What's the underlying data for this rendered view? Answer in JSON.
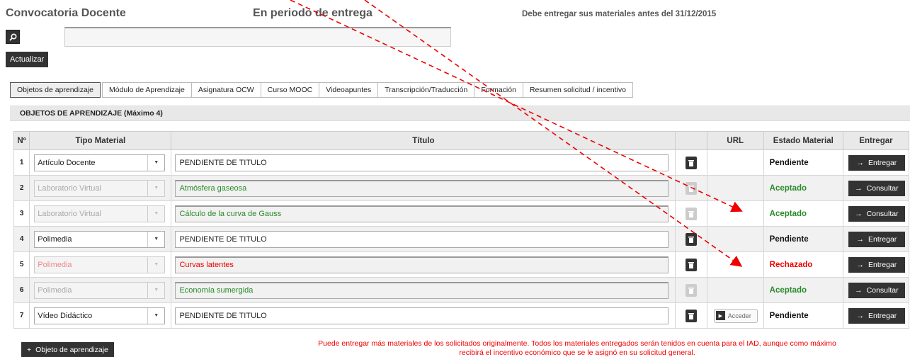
{
  "header": {
    "title": "Convocatoria Docente",
    "status": "En periodo de entrega",
    "note": "Debe entregar sus materiales antes del 31/12/2015"
  },
  "toolbar": {
    "update_label": "Actualizar",
    "search_icon": "search-icon"
  },
  "tabs": [
    {
      "label": "Objetos de aprendizaje",
      "active": true
    },
    {
      "label": "Módulo de Aprendizaje"
    },
    {
      "label": "Asignatura OCW"
    },
    {
      "label": "Curso MOOC"
    },
    {
      "label": "Videoapuntes"
    },
    {
      "label": "Transcripción/Traducción"
    },
    {
      "label": "Formación"
    },
    {
      "label": "Resumen solicitud / incentivo"
    }
  ],
  "section": {
    "title": "OBJETOS DE APRENDIZAJE (Máximo 4)"
  },
  "table": {
    "headers": {
      "num": "Nº",
      "tipo": "Tipo Material",
      "titulo": "Título",
      "url": "URL",
      "estado": "Estado Material",
      "entregar": "Entregar"
    },
    "rows": [
      {
        "n": "1",
        "tipo": "Artículo Docente",
        "titulo": "PENDIENTE DE TITULO",
        "estado": "Pendiente",
        "accion": "Entregar"
      },
      {
        "n": "2",
        "tipo": "Laboratorio Virtual",
        "titulo": "Atmósfera gaseosa",
        "estado": "Aceptado",
        "accion": "Consultar"
      },
      {
        "n": "3",
        "tipo": "Laboratorio Virtual",
        "titulo": "Cálculo de la curva de Gauss",
        "estado": "Aceptado",
        "accion": "Consultar"
      },
      {
        "n": "4",
        "tipo": "Polimedia",
        "titulo": "PENDIENTE DE TITULO",
        "estado": "Pendiente",
        "accion": "Entregar"
      },
      {
        "n": "5",
        "tipo": "Polimedia",
        "titulo": "Curvas latentes",
        "estado": "Rechazado",
        "accion": "Entregar"
      },
      {
        "n": "6",
        "tipo": "Polimedia",
        "titulo": "Economía sumergida",
        "estado": "Aceptado",
        "accion": "Consultar"
      },
      {
        "n": "7",
        "tipo": "Vídeo Didáctico",
        "titulo": "PENDIENTE DE TITULO",
        "estado": "Pendiente",
        "accion": "Entregar",
        "url_label": "Acceder"
      }
    ]
  },
  "footer": {
    "add_label": "Objeto de aprendizaje",
    "note_line1": "Puede entregar más materiales de los solicitados originalmente. Todos los materiales entregados serán tenidos en cuenta para el IAD, aunque como máximo",
    "note_line2": "recibirá el incentivo económico que se le asignó en su solicitud general."
  },
  "colors": {
    "accepted": "#2a8a2a",
    "rejected": "#e00000",
    "annotation": "#e00000"
  }
}
